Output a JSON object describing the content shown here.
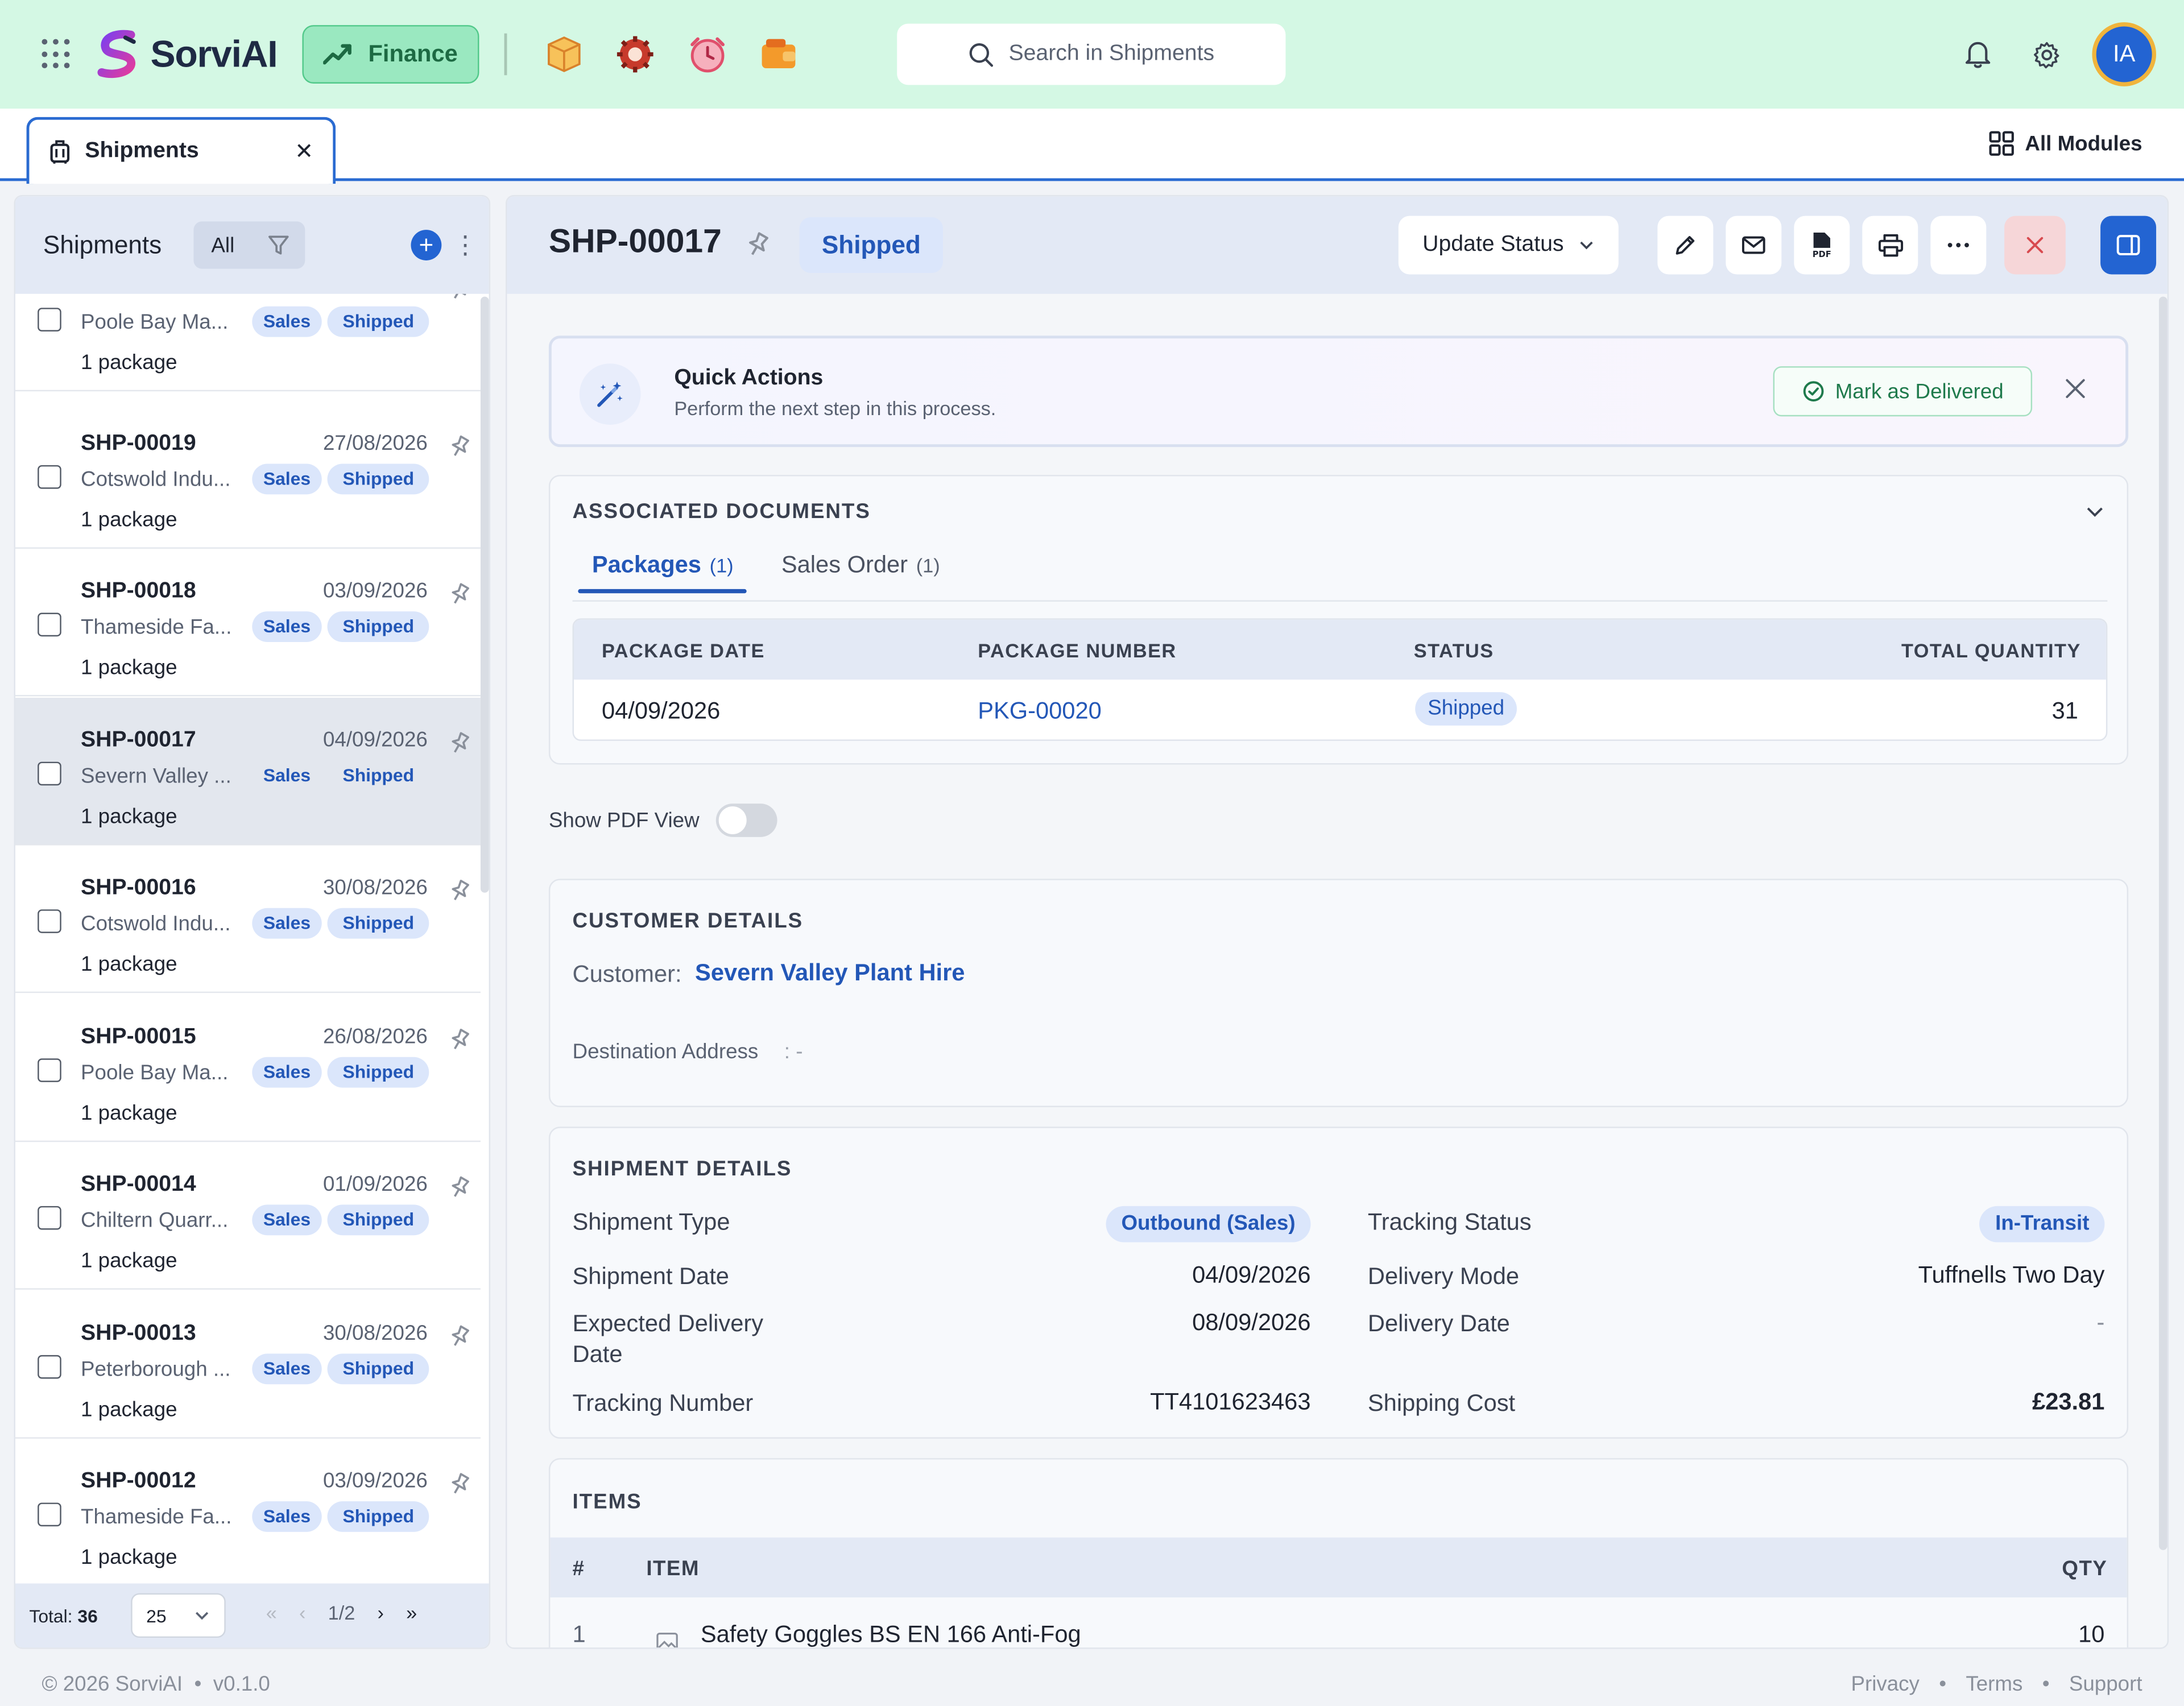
{
  "app": {
    "name": "SorviAI",
    "module": "Finance",
    "search_placeholder": "Search in Shipments",
    "avatar_initials": "IA",
    "accent": "#2364d2",
    "topbar_bg": "#d4f8e4"
  },
  "tabs": {
    "active": "Shipments",
    "all_modules": "All Modules"
  },
  "list": {
    "title": "Shipments",
    "filter_all": "All",
    "items": [
      {
        "number": "",
        "date": "",
        "customer": "Poole Bay Ma...",
        "type": "Sales",
        "status": "Shipped",
        "packages": "1 package"
      },
      {
        "number": "SHP-00019",
        "date": "27/08/2026",
        "customer": "Cotswold Indu...",
        "type": "Sales",
        "status": "Shipped",
        "packages": "1 package"
      },
      {
        "number": "SHP-00018",
        "date": "03/09/2026",
        "customer": "Thameside Fa...",
        "type": "Sales",
        "status": "Shipped",
        "packages": "1 package"
      },
      {
        "number": "SHP-00017",
        "date": "04/09/2026",
        "customer": "Severn Valley ...",
        "type": "Sales",
        "status": "Shipped",
        "packages": "1 package"
      },
      {
        "number": "SHP-00016",
        "date": "30/08/2026",
        "customer": "Cotswold Indu...",
        "type": "Sales",
        "status": "Shipped",
        "packages": "1 package"
      },
      {
        "number": "SHP-00015",
        "date": "26/08/2026",
        "customer": "Poole Bay Ma...",
        "type": "Sales",
        "status": "Shipped",
        "packages": "1 package"
      },
      {
        "number": "SHP-00014",
        "date": "01/09/2026",
        "customer": "Chiltern Quarr...",
        "type": "Sales",
        "status": "Shipped",
        "packages": "1 package"
      },
      {
        "number": "SHP-00013",
        "date": "30/08/2026",
        "customer": "Peterborough ...",
        "type": "Sales",
        "status": "Shipped",
        "packages": "1 package"
      },
      {
        "number": "SHP-00012",
        "date": "03/09/2026",
        "customer": "Thameside Fa...",
        "type": "Sales",
        "status": "Shipped",
        "packages": "1 package"
      }
    ],
    "footer": {
      "total_label": "Total:",
      "total": "36",
      "page_size": "25",
      "page": "1/2"
    }
  },
  "detail": {
    "number": "SHP-00017",
    "status": "Shipped",
    "update_status": "Update Status",
    "quick_actions": {
      "title": "Quick Actions",
      "subtitle": "Perform the next step in this process.",
      "action": "Mark as Delivered"
    },
    "associated_documents": {
      "title": "ASSOCIATED DOCUMENTS",
      "tabs": [
        {
          "label": "Packages",
          "count": "(1)"
        },
        {
          "label": "Sales Order",
          "count": "(1)"
        }
      ],
      "columns": [
        "PACKAGE DATE",
        "PACKAGE NUMBER",
        "STATUS",
        "TOTAL QUANTITY"
      ],
      "rows": [
        {
          "date": "04/09/2026",
          "number": "PKG-00020",
          "status": "Shipped",
          "quantity": "31"
        }
      ]
    },
    "pdf_toggle": {
      "label": "Show PDF View",
      "on": false
    },
    "customer_details": {
      "title": "CUSTOMER DETAILS",
      "customer_label": "Customer:",
      "customer": "Severn Valley Plant Hire",
      "destination_label": "Destination Address",
      "destination": ": -"
    },
    "shipment_details": {
      "title": "SHIPMENT DETAILS",
      "shipment_type_label": "Shipment Type",
      "shipment_type": "Outbound (Sales)",
      "tracking_status_label": "Tracking Status",
      "tracking_status": "In-Transit",
      "shipment_date_label": "Shipment Date",
      "shipment_date": "04/09/2026",
      "delivery_mode_label": "Delivery Mode",
      "delivery_mode": "Tuffnells Two Day",
      "expected_delivery_label_1": "Expected Delivery",
      "expected_delivery_label_2": "Date",
      "expected_delivery": "08/09/2026",
      "delivery_date_label": "Delivery Date",
      "delivery_date": "-",
      "tracking_number_label": "Tracking Number",
      "tracking_number": "TT4101623463",
      "shipping_cost_label": "Shipping Cost",
      "shipping_cost": "£23.81"
    },
    "items": {
      "title": "ITEMS",
      "columns": [
        "#",
        "ITEM",
        "QTY"
      ],
      "rows": [
        {
          "index": "1",
          "name": "Safety Goggles BS EN 166 Anti-Fog",
          "qty": "10"
        }
      ]
    }
  },
  "footer": {
    "copyright": "© 2026 SorviAI",
    "version": "v0.1.0",
    "links": [
      "Privacy",
      "Terms",
      "Support"
    ]
  }
}
